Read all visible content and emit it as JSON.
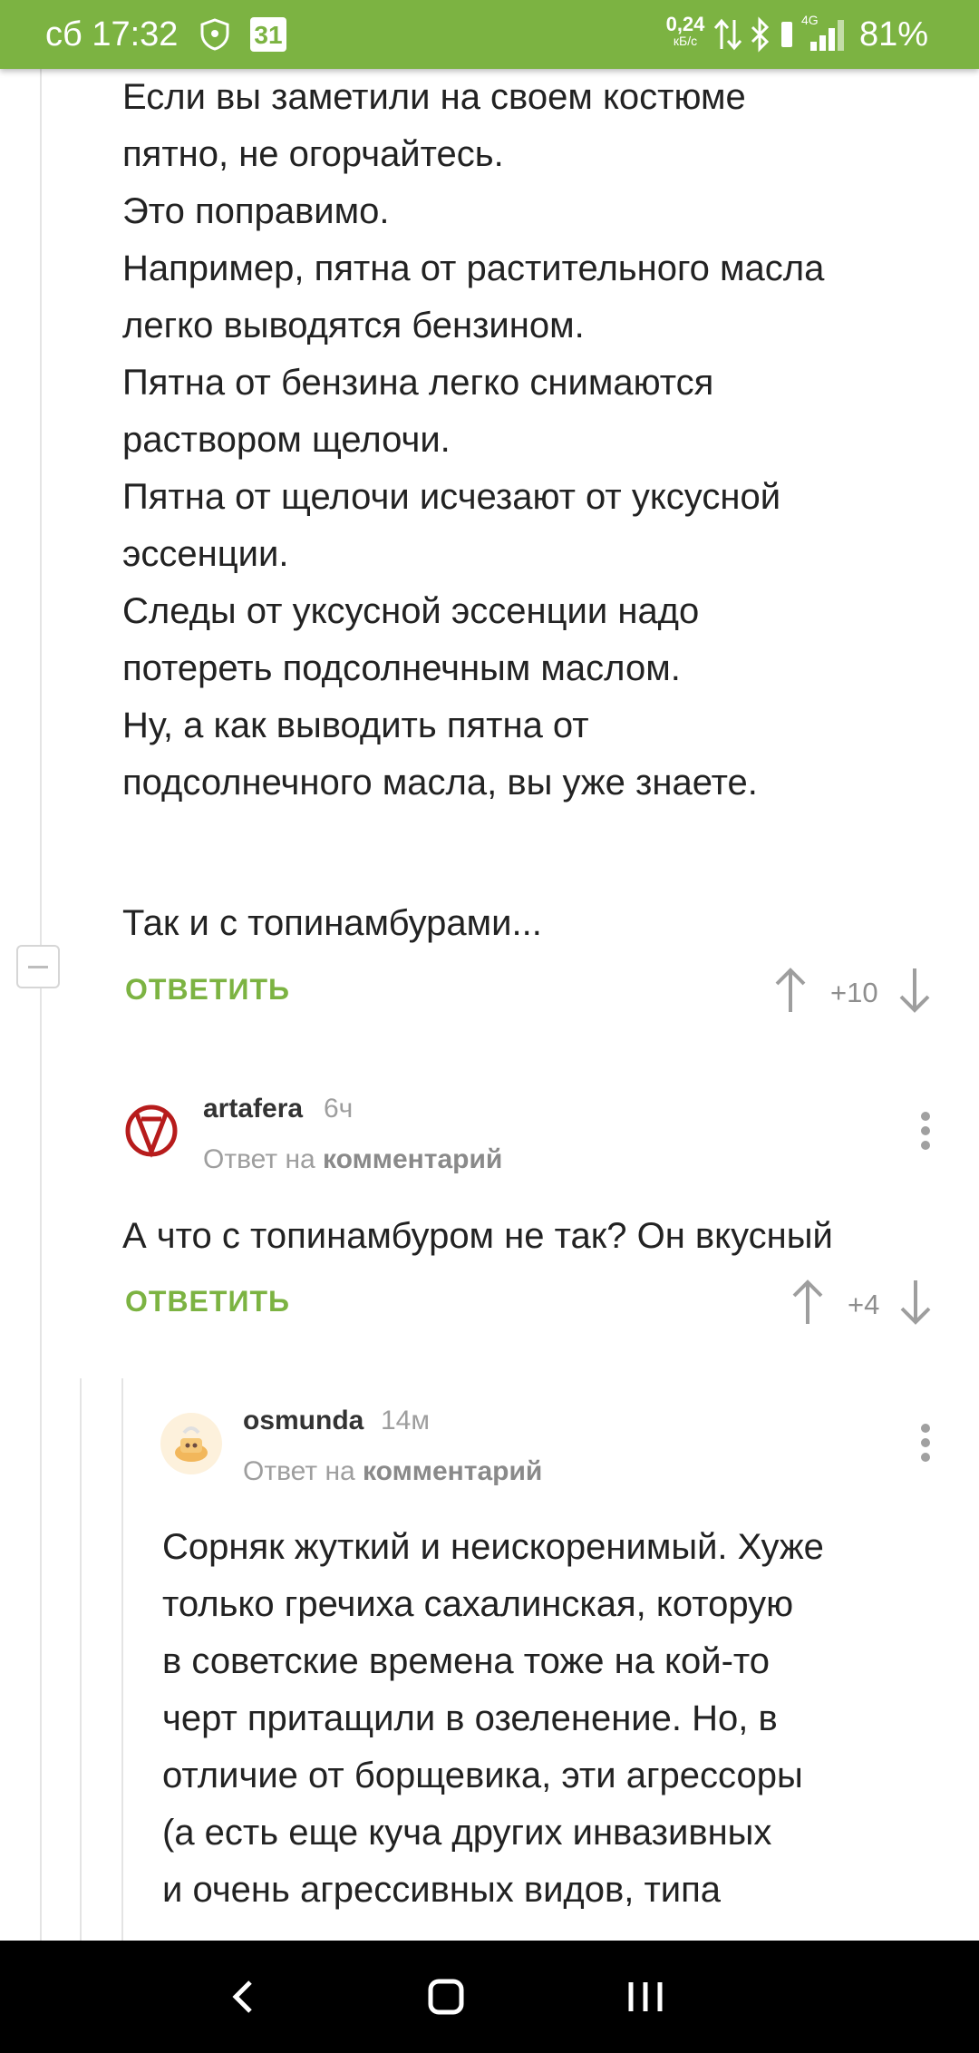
{
  "status_bar": {
    "time": "сб 17:32",
    "calendar_badge": "31",
    "net_speed_value": "0,24",
    "net_speed_unit": "кБ/с",
    "network_type": "4G",
    "battery": "81%"
  },
  "comment1": {
    "lines": [
      "Если вы заметили на своем костюме",
      "пятно, не огорчайтесь.",
      "Это поправимо.",
      "Например, пятна от растительного масла",
      "легко выводятся бензином.",
      "Пятна от бензина легко снимаются",
      "раствором щелочи.",
      "Пятна от щелочи исчезают от уксусной",
      "эссенции.",
      "Следы от уксусной эссенции надо",
      "потереть подсолнечным маслом.",
      "Ну, а как выводить пятна от",
      "подсолнечного масла, вы уже знаете."
    ],
    "last_line": "Так и с топинамбурами...",
    "reply_label": "ОТВЕТИТЬ",
    "score": "+10"
  },
  "comment2": {
    "username": "artafera",
    "time": "6ч",
    "reply_prefix": "Ответ на",
    "reply_target": "комментарий",
    "text": "А что с топинамбуром не так? Он вкусный",
    "reply_label": "ОТВЕТИТЬ",
    "score": "+4"
  },
  "comment3": {
    "username": "osmunda",
    "time": "14м",
    "reply_prefix": "Ответ на",
    "reply_target": "комментарий",
    "lines": [
      "Сорняк жуткий и неискоренимый. Хуже",
      "только гречиха сахалинская, которую",
      "в советские времена тоже на кой-то",
      "черт притащили в озеленение. Но, в",
      "отличие от борщевика, эти агрессоры",
      "(а есть еще куча других инвазивных",
      "и очень агрессивных видов, типа"
    ]
  },
  "colors": {
    "accent": "#7cb342",
    "text": "#222222",
    "muted": "#9e9e9e"
  }
}
